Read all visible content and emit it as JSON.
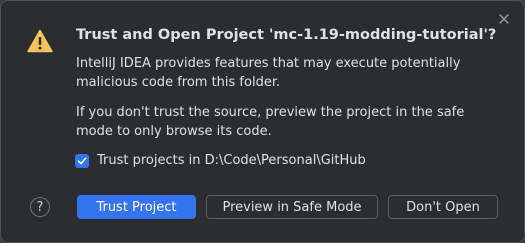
{
  "dialog": {
    "title": "Trust and Open Project 'mc-1.19-modding-tutorial'?",
    "paragraph1": "IntelliJ IDEA provides features that may execute potentially malicious code from this folder.",
    "paragraph2": "If you don't trust the source, preview the project in the safe mode to only browse its code.",
    "checkbox": {
      "label": "Trust projects in D:\\Code\\Personal\\GitHub",
      "checked": true
    },
    "help_label": "?",
    "buttons": {
      "trust": "Trust Project",
      "safe_mode": "Preview in Safe Mode",
      "dont_open": "Don't Open"
    },
    "icons": {
      "warning": "warning-icon",
      "close": "close-icon",
      "check": "checkmark-icon"
    },
    "colors": {
      "background": "#2b2d30",
      "accent": "#3574f0",
      "warning": "#f2c55c",
      "text": "#dfe1e5"
    }
  }
}
